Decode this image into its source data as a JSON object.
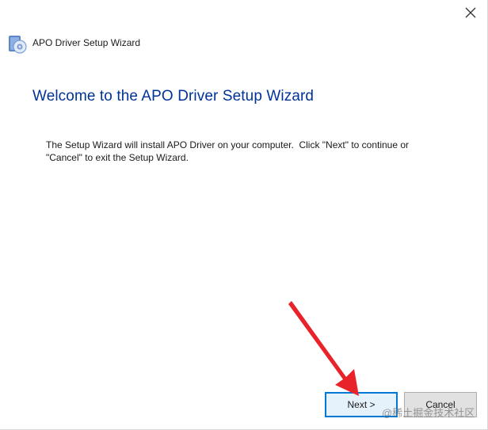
{
  "window": {
    "title": "APO Driver Setup Wizard",
    "close_icon": "close-icon",
    "app_icon": "setup-disc-icon"
  },
  "main": {
    "heading": "Welcome to the APO Driver Setup Wizard",
    "description": "The Setup Wizard will install APO Driver on your computer.  Click \"Next\" to continue or\n\"Cancel\" to exit the Setup Wizard."
  },
  "buttons": {
    "next_label": "Next >",
    "cancel_label": "Cancel"
  },
  "overlay": {
    "watermark": "@稀土掘金技术社区",
    "arrow_color": "#e8232a"
  },
  "colors": {
    "heading": "#003399",
    "focus_border": "#0078d7"
  }
}
